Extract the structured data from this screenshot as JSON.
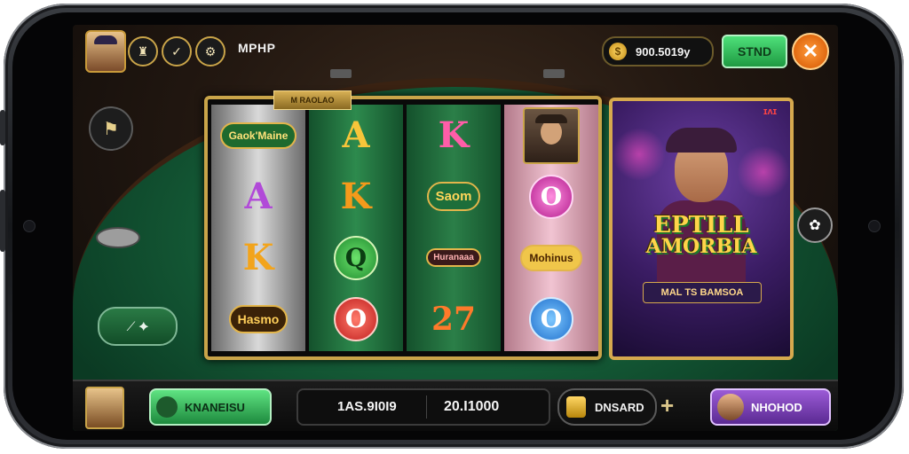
{
  "topbar": {
    "title": "MPHP",
    "coins": "900.5019y",
    "store_label": "STND",
    "close_icon": "✕"
  },
  "reels": {
    "banner_text": "M RAOLAO",
    "col1": [
      "Gaok'Maine",
      "A",
      "K",
      "Hasmo"
    ],
    "col2": [
      "A",
      "K",
      "Q",
      "O"
    ],
    "col3": [
      "K",
      "Saom",
      "Huranaaa",
      "27"
    ],
    "col4": [
      "",
      "O",
      "Mohinus",
      "O"
    ]
  },
  "feature": {
    "title_line1": "EPTILL",
    "title_line2": "AMORBIA",
    "subtitle": "MAL TS BAMSOA",
    "badge": "ɪʌɪ"
  },
  "bottombar": {
    "green_label": "KNANEISU",
    "stat1": "1AS.9I0I9",
    "stat2": "20.I1000",
    "board_label": "DNSARD",
    "plus_icon": "+",
    "purple_label": "NHOHOD"
  },
  "colors": {
    "felt": "#1f7a4a",
    "gold": "#c9a449",
    "store_green": "#4ee07a",
    "close_orange": "#ff9b3a",
    "purple": "#9b5bd6"
  }
}
